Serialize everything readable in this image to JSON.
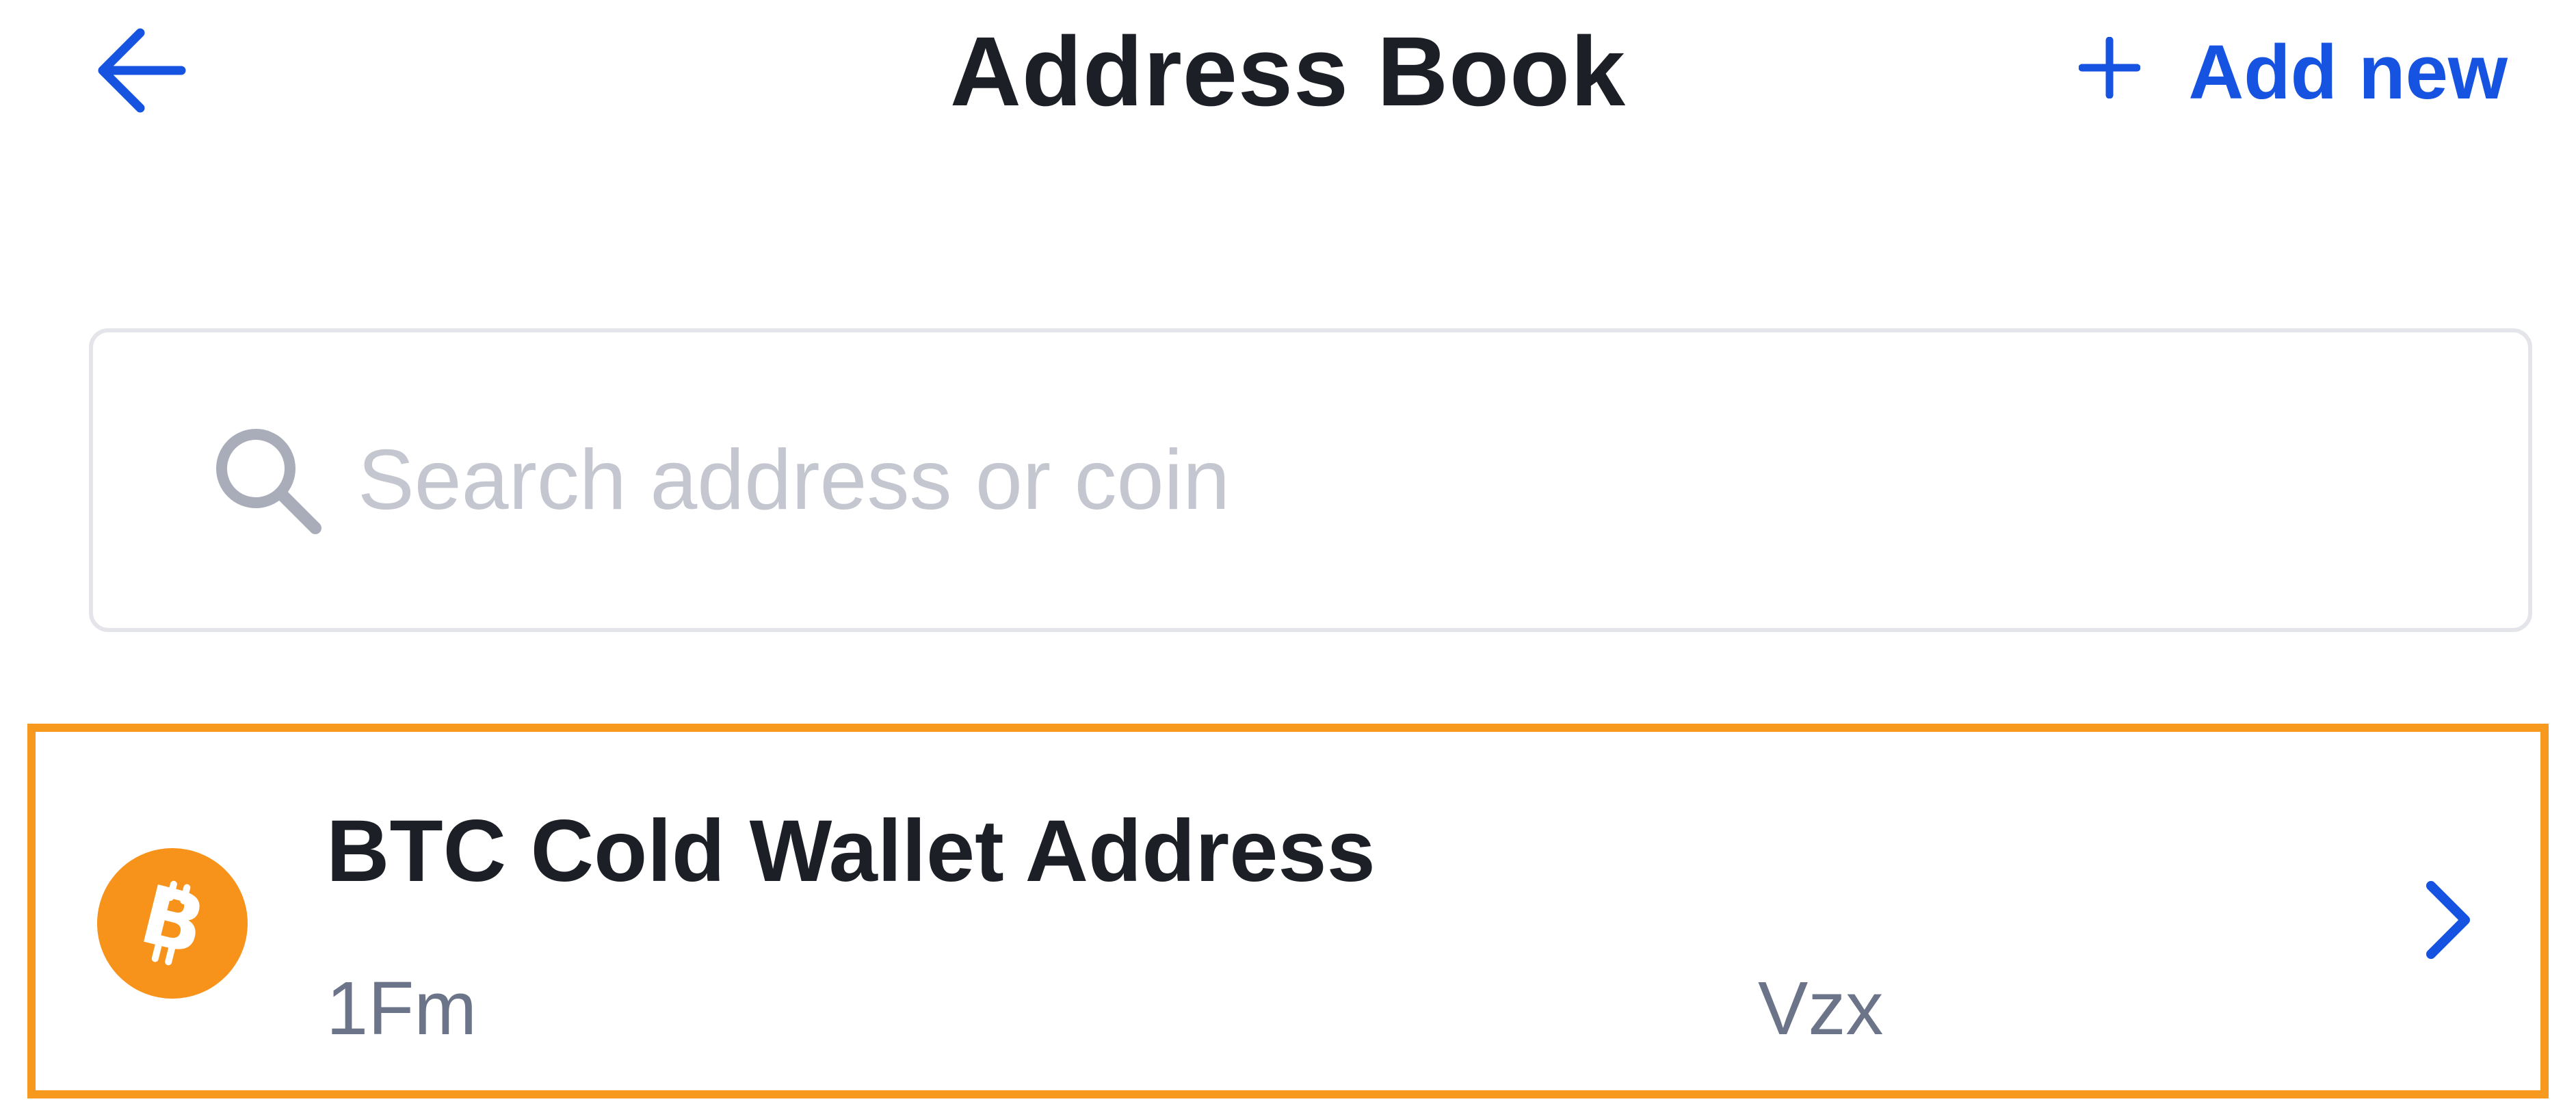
{
  "header": {
    "title": "Address Book",
    "add_new_label": "Add new",
    "back_icon": "arrow-left-icon",
    "add_icon": "plus-icon"
  },
  "search": {
    "placeholder": "Search address or coin",
    "value": "",
    "icon": "search-icon"
  },
  "addresses": [
    {
      "name": "BTC Cold Wallet Address",
      "address_start": "1Fm",
      "address_end": "Vzx",
      "coin_icon": "bitcoin-icon",
      "coin_color": "#F7931A"
    }
  ],
  "colors": {
    "accent": "#1553E0",
    "highlight_border": "#F7991F",
    "secondary_text": "#6B7488",
    "placeholder_text": "#C4C7D0"
  }
}
